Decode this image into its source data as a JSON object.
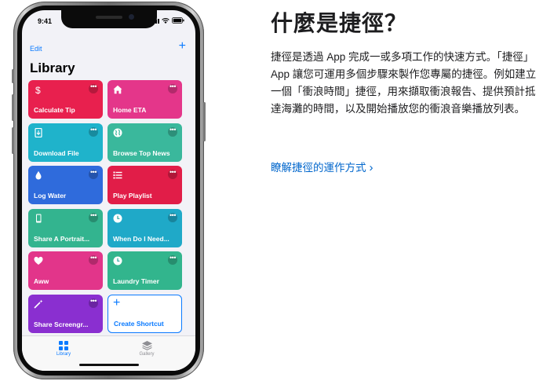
{
  "phone": {
    "status_time": "9:41",
    "nav": {
      "edit_label": "Edit",
      "add_label": "+"
    },
    "library_title": "Library",
    "tiles": [
      {
        "label": "Calculate Tip",
        "color": "#e8204e",
        "icon": "dollar-icon",
        "glyph": "$"
      },
      {
        "label": "Home ETA",
        "color": "#e4368a",
        "icon": "home-icon",
        "glyph": ""
      },
      {
        "label": "Download File",
        "color": "#1fb3cb",
        "icon": "download-file-icon",
        "glyph": ""
      },
      {
        "label": "Browse Top News",
        "color": "#3ab89c",
        "icon": "globe-icon",
        "glyph": ""
      },
      {
        "label": "Log Water",
        "color": "#2f6bdc",
        "icon": "water-drop-icon",
        "glyph": ""
      },
      {
        "label": "Play Playlist",
        "color": "#e11d48",
        "icon": "list-icon",
        "glyph": ""
      },
      {
        "label": "Share A Portrait...",
        "color": "#33b48f",
        "icon": "phone-portrait-icon",
        "glyph": ""
      },
      {
        "label": "When Do I Need...",
        "color": "#1fa9c8",
        "icon": "clock-icon",
        "glyph": ""
      },
      {
        "label": "Aww",
        "color": "#e2358a",
        "icon": "heart-icon",
        "glyph": ""
      },
      {
        "label": "Laundry Timer",
        "color": "#32b58d",
        "icon": "clock-icon",
        "glyph": ""
      },
      {
        "label": "Share Screengr...",
        "color": "#8a2fd0",
        "icon": "magic-wand-icon",
        "glyph": ""
      }
    ],
    "create_label": "Create Shortcut",
    "more_glyph": "•••",
    "tabs": [
      {
        "label": "Library",
        "active": true,
        "color": "#0a7aff"
      },
      {
        "label": "Gallery",
        "active": false,
        "color": "#8e8e93"
      }
    ]
  },
  "heading": "什麼是捷徑？",
  "paragraph": "捷徑是透過 App 完成一或多項工作的快速方式。「捷徑」App 讓您可運用多個步驟來製作您專屬的捷徑。例如建立一個「衝浪時間」捷徑，用來擷取衝浪報告、提供預計抵達海灘的時間，以及開始播放您的衝浪音樂播放列表。",
  "learn_more": "瞭解捷徑的運作方式",
  "link_chevron": "›",
  "colors": {
    "accent": "#0a7aff",
    "link": "#0066cc"
  }
}
